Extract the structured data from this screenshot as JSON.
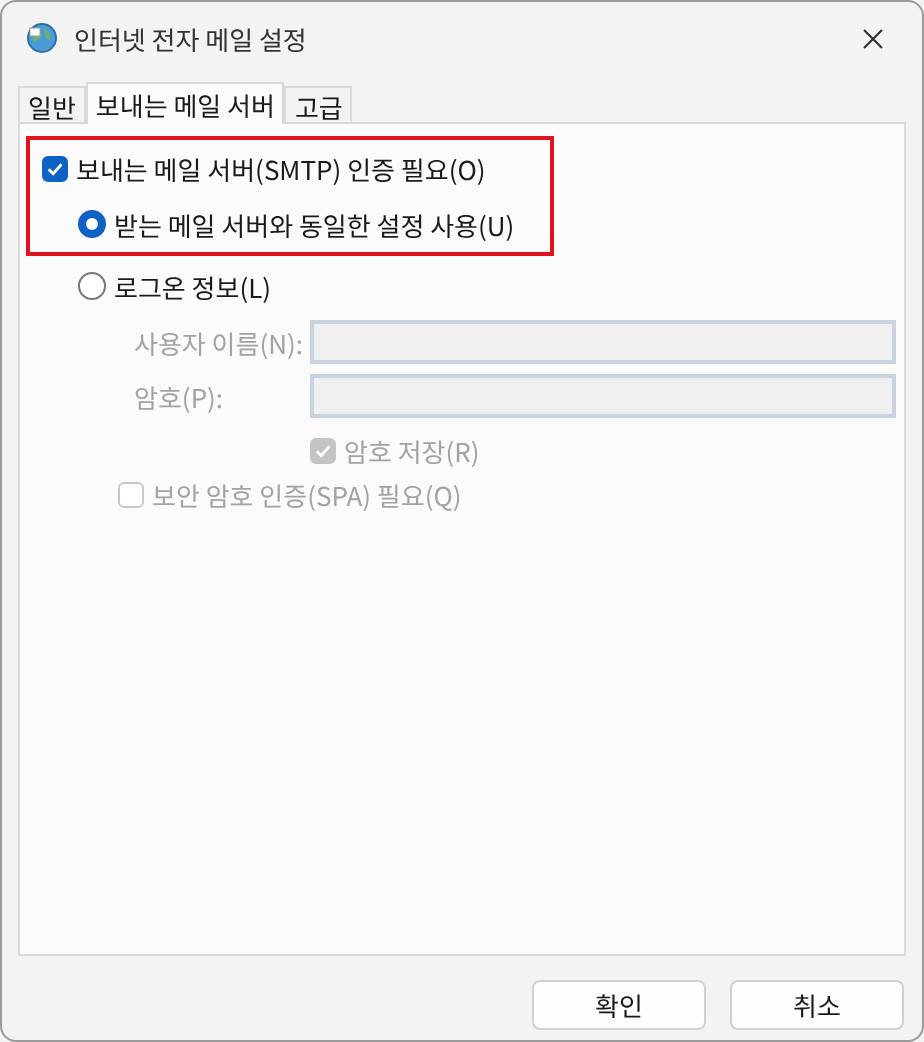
{
  "window": {
    "title": "인터넷 전자 메일 설정"
  },
  "tabs": [
    {
      "label": "일반",
      "selected": false
    },
    {
      "label": "보내는 메일 서버",
      "selected": true
    },
    {
      "label": "고급",
      "selected": false
    }
  ],
  "auth": {
    "label": "보내는 메일 서버(SMTP) 인증 필요(O)",
    "checked": true,
    "highlighted": true
  },
  "options": [
    {
      "label": "받는 메일 서버와 동일한 설정 사용(U)",
      "selected": true
    },
    {
      "label": "로그온 정보(L)",
      "selected": false
    }
  ],
  "fields": [
    {
      "label": "사용자 이름(N):",
      "disabled": true
    },
    {
      "label": "암호(P):",
      "disabled": true
    }
  ],
  "checks": [
    {
      "label": "암호 저장(R)",
      "checked": true,
      "disabled": true
    },
    {
      "label": "보안 암호 인증(SPA) 필요(Q)",
      "checked": false,
      "disabled": true
    }
  ],
  "buttons": [
    {
      "label": "확인"
    },
    {
      "label": "취소"
    }
  ]
}
